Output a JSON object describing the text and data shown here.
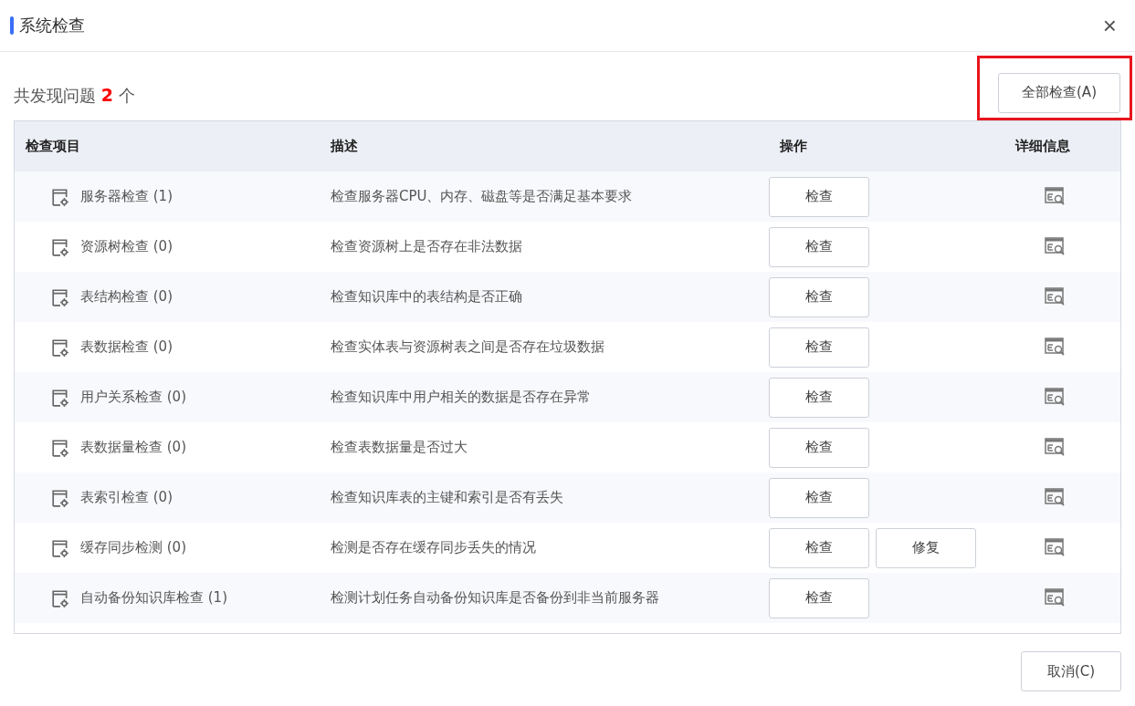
{
  "dialog": {
    "title": "系统检查",
    "close": "×"
  },
  "summary": {
    "prefix": "共发现问题",
    "count": "2",
    "suffix": "个"
  },
  "check_all_button": {
    "label": "全部检查(A)",
    "highlighted": true
  },
  "table": {
    "columns": [
      "检查项目",
      "描述",
      "操作",
      "详细信息"
    ],
    "rows": [
      {
        "name": "服务器检查 (1)",
        "description": "检查服务器CPU、内存、磁盘等是否满足基本要求",
        "actions": [
          "检查"
        ]
      },
      {
        "name": "资源树检查 (0)",
        "description": "检查资源树上是否存在非法数据",
        "actions": [
          "检查"
        ]
      },
      {
        "name": "表结构检查 (0)",
        "description": "检查知识库中的表结构是否正确",
        "actions": [
          "检查"
        ]
      },
      {
        "name": "表数据检查 (0)",
        "description": "检查实体表与资源树表之间是否存在垃圾数据",
        "actions": [
          "检查"
        ]
      },
      {
        "name": "用户关系检查 (0)",
        "description": "检查知识库中用户相关的数据是否存在异常",
        "actions": [
          "检查"
        ]
      },
      {
        "name": "表数据量检查 (0)",
        "description": "检查表数据量是否过大",
        "actions": [
          "检查"
        ]
      },
      {
        "name": "表索引检查 (0)",
        "description": "检查知识库表的主键和索引是否有丢失",
        "actions": [
          "检查"
        ]
      },
      {
        "name": "缓存同步检测 (0)",
        "description": "检测是否存在缓存同步丢失的情况",
        "actions": [
          "检查",
          "修复"
        ]
      },
      {
        "name": "自动备份知识库检查 (1)",
        "description": "检测计划任务自动备份知识库是否备份到非当前服务器",
        "actions": [
          "检查"
        ]
      }
    ]
  },
  "cancel_button": "取消(C)"
}
